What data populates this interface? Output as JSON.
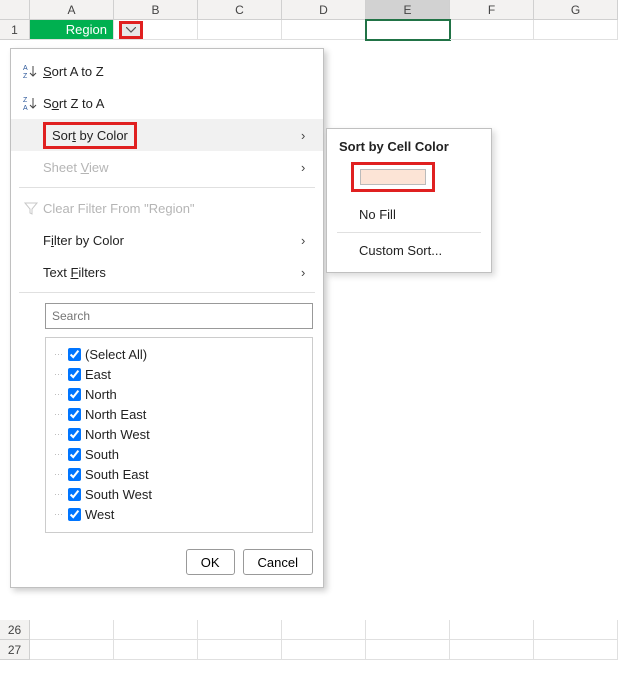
{
  "columns": [
    "A",
    "B",
    "C",
    "D",
    "E",
    "F",
    "G"
  ],
  "selected_column": "E",
  "header_cell": {
    "label": "Region",
    "bg": "#00b050"
  },
  "visible_bottom_rows": [
    "26",
    "27"
  ],
  "menu": {
    "sort_az": "Sort A to Z",
    "sort_za": "Sort Z to A",
    "sort_color": "Sort by Color",
    "sheet_view": "Sheet View",
    "clear_filter": "Clear Filter From \"Region\"",
    "filter_color": "Filter by Color",
    "text_filters": "Text Filters",
    "search_placeholder": "Search",
    "ok": "OK",
    "cancel": "Cancel"
  },
  "tree_items": [
    "(Select All)",
    "East",
    "North",
    "North East",
    "North West",
    "South",
    "South East",
    "South West",
    "West"
  ],
  "submenu": {
    "title": "Sort by Cell Color",
    "swatch_color": "#fce4d6",
    "no_fill": "No Fill",
    "custom_sort": "Custom Sort..."
  },
  "highlight": {
    "filter_button": true,
    "sort_by_color": true,
    "swatch": true
  },
  "chart_data": null
}
